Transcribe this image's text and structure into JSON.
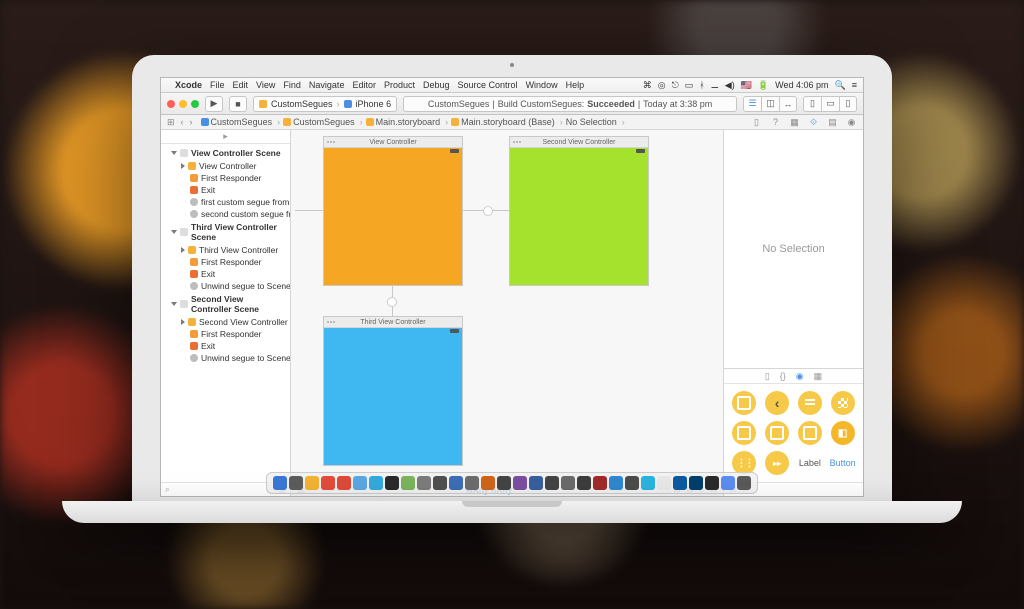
{
  "menubar": {
    "app": "Xcode",
    "items": [
      "File",
      "Edit",
      "View",
      "Find",
      "Navigate",
      "Editor",
      "Product",
      "Debug",
      "Source Control",
      "Window",
      "Help"
    ],
    "status_time": "Wed 4:06 pm"
  },
  "toolbar": {
    "scheme_app": "CustomSegues",
    "scheme_device": "iPhone 6",
    "status_app": "CustomSegues",
    "status_text": "Build CustomSegues:",
    "status_result": "Succeeded",
    "status_time": "Today at 3:38 pm"
  },
  "jumpbar": {
    "crumbs": [
      "CustomSegues",
      "CustomSegues",
      "Main.storyboard",
      "Main.storyboard (Base)",
      "No Selection"
    ]
  },
  "navigator": {
    "scenes": [
      {
        "title": "View Controller Scene",
        "items": [
          {
            "icon": "vc",
            "label": "View Controller",
            "disclosure": "r"
          },
          {
            "icon": "fr",
            "label": "First Responder"
          },
          {
            "icon": "ex",
            "label": "Exit"
          },
          {
            "icon": "seg",
            "label": "first custom segue from View Co..."
          },
          {
            "icon": "seg",
            "label": "second custom segue from View..."
          }
        ]
      },
      {
        "title": "Third View Controller Scene",
        "items": [
          {
            "icon": "vc",
            "label": "Third View Controller",
            "disclosure": "r"
          },
          {
            "icon": "fr",
            "label": "First Responder"
          },
          {
            "icon": "ex",
            "label": "Exit"
          },
          {
            "icon": "seg",
            "label": "Unwind segue to Scene Exit Pla..."
          }
        ]
      },
      {
        "title": "Second View Controller Scene",
        "items": [
          {
            "icon": "vc",
            "label": "Second View Controller",
            "disclosure": "r"
          },
          {
            "icon": "fr",
            "label": "First Responder"
          },
          {
            "icon": "ex",
            "label": "Exit"
          },
          {
            "icon": "seg",
            "label": "Unwind segue to Scene Exit Pla..."
          }
        ]
      }
    ]
  },
  "canvas": {
    "vc1_title": "View Controller",
    "vc2_title": "Second View Controller",
    "vc3_title": "Third View Controller",
    "size_class_w": "wAny",
    "size_class_h": "hAny"
  },
  "inspector": {
    "no_selection": "No Selection",
    "lib_label": "Label",
    "lib_button": "Button"
  },
  "dock_colors": [
    "#3a78d6",
    "#5c5c5c",
    "#f2b233",
    "#e14d3a",
    "#dd4b39",
    "#5aa7e2",
    "#34aadc",
    "#2a2a2a",
    "#7ab45c",
    "#7c7c7c",
    "#505050",
    "#3d6db5",
    "#6c6c6c",
    "#d0651a",
    "#444",
    "#7d4ea0",
    "#385f9e",
    "#444",
    "#6a6a6a",
    "#3c3c3c",
    "#a02a2a",
    "#2f88d0",
    "#4c4c4c",
    "#2bb3e0",
    "#e8e8e8",
    "#0b5aa0",
    "#003e6b",
    "#2a2a2a",
    "#5b8def",
    "#5a5a5a"
  ]
}
